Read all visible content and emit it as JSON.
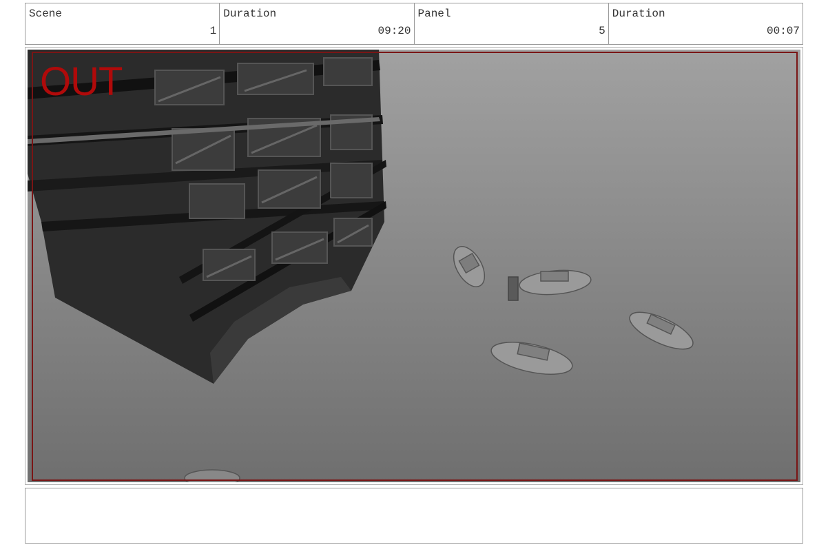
{
  "header": {
    "scene_label": "Scene",
    "scene_value": "1",
    "scene_duration_label": "Duration",
    "scene_duration_value": "09:20",
    "panel_label": "Panel",
    "panel_value": "5",
    "panel_duration_label": "Duration",
    "panel_duration_value": "00:07"
  },
  "viewport": {
    "overlay_text": "OUT",
    "overlay_color": "#b00a0a",
    "frame_color": "#7a1515"
  },
  "notes": {
    "text": ""
  }
}
